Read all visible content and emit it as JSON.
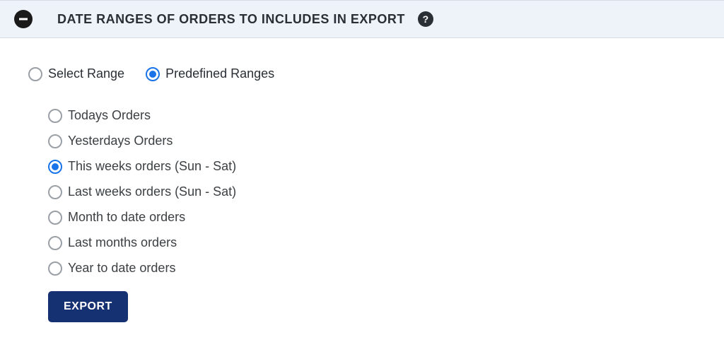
{
  "section": {
    "title": "DATE RANGES OF ORDERS TO INCLUDES IN EXPORT"
  },
  "rangeType": {
    "select": "Select Range",
    "predefined": "Predefined Ranges",
    "selected": "predefined"
  },
  "predefinedOptions": {
    "today": "Todays Orders",
    "yesterday": "Yesterdays Orders",
    "thisWeek": "This weeks orders (Sun - Sat)",
    "lastWeek": "Last weeks orders (Sun - Sat)",
    "monthToDate": "Month to date orders",
    "lastMonth": "Last months orders",
    "yearToDate": "Year to date orders",
    "selected": "thisWeek"
  },
  "buttons": {
    "export": "EXPORT"
  }
}
